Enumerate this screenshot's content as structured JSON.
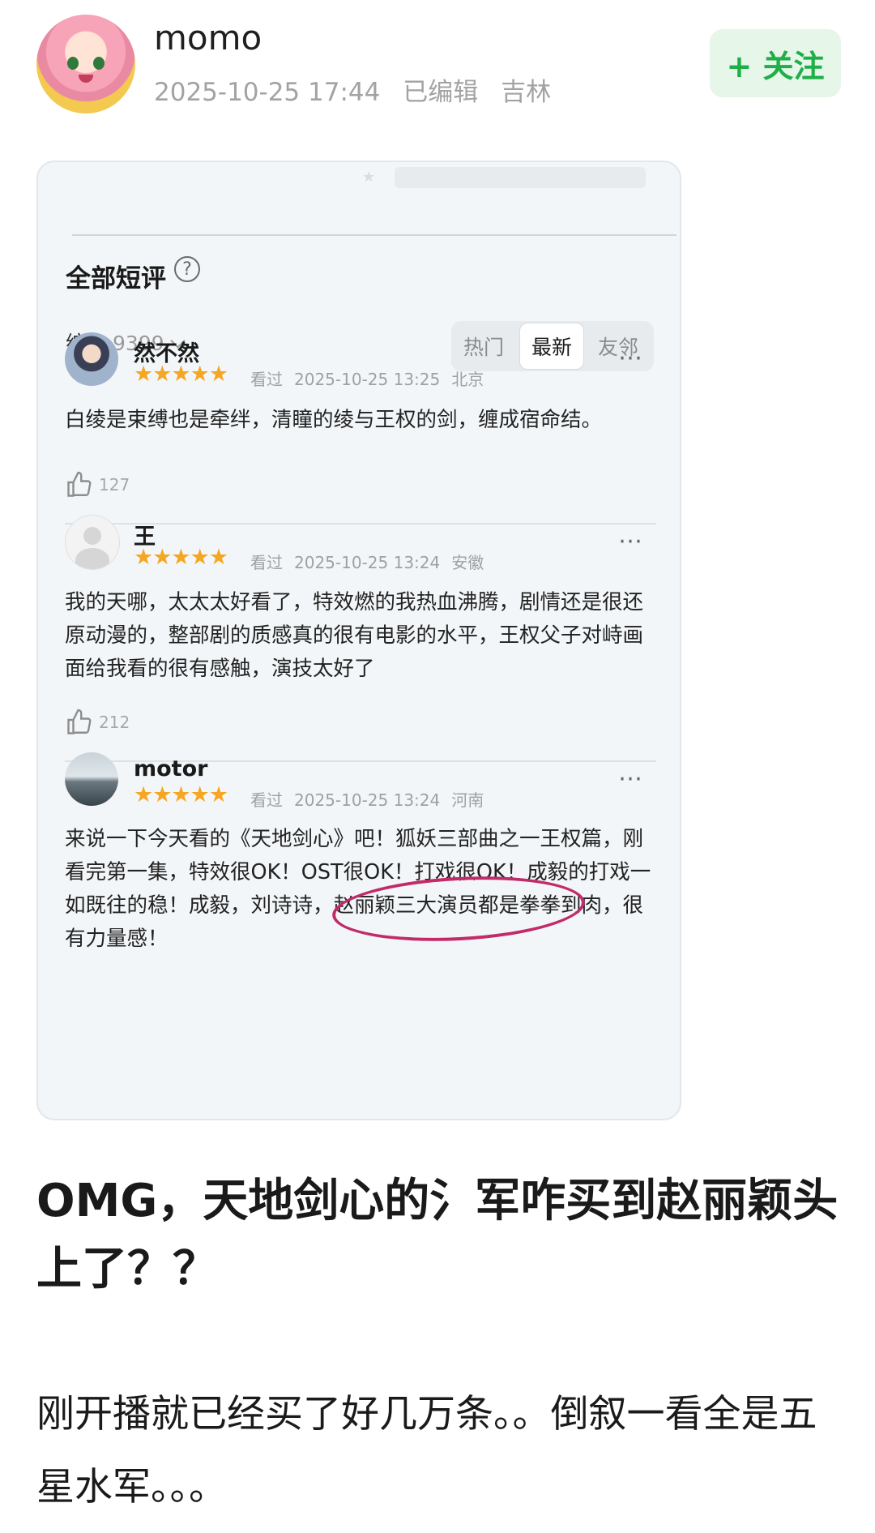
{
  "post": {
    "username": "momo",
    "timestamp": "2025-10-25 17:44",
    "edited": "已编辑",
    "location": "吉林",
    "follow_label": "+ 关注",
    "headline": "OMG，天地剑心的氵军咋买到赵丽颖头上了？？",
    "body": "刚开播就已经买了好几万条。。倒叙一看全是五星水军。。。"
  },
  "screenshot": {
    "section_title": "全部短评",
    "sort": {
      "label": "综合",
      "count": "9399"
    },
    "tabs": [
      {
        "label": "热门",
        "active": false
      },
      {
        "label": "最新",
        "active": true
      },
      {
        "label": "友邻",
        "active": false
      }
    ],
    "reviews": [
      {
        "name": "然不然",
        "stars": "★★★★★",
        "status": "看过",
        "time": "2025-10-25 13:25",
        "location": "北京",
        "text": "白绫是束缚也是牵绊，清瞳的绫与王权的剑，缠成宿命结。",
        "likes": "127"
      },
      {
        "name": "王",
        "stars": "★★★★★",
        "status": "看过",
        "time": "2025-10-25 13:24",
        "location": "安徽",
        "text": "我的天哪，太太太好看了，特效燃的我热血沸腾，剧情还是很还原动漫的，整部剧的质感真的很有电影的水平，王权父子对峙画面给我看的很有感触，演技太好了",
        "likes": "212"
      },
      {
        "name": "motor",
        "stars": "★★★★★",
        "status": "看过",
        "time": "2025-10-25 13:24",
        "location": "河南",
        "text": "来说一下今天看的《天地剑心》吧！狐妖三部曲之一王权篇，刚看完第一集，特效很OK！OST很OK！打戏很OK！成毅的打戏一如既往的稳！成毅，刘诗诗，赵丽颖三大演员都是拳拳到肉，很有力量感！"
      }
    ],
    "more_icon": "⋯",
    "help_icon": "?"
  },
  "colors": {
    "follow_green": "#1fae48",
    "star_orange": "#f5a623",
    "circle_annotation": "#c22a6a"
  }
}
